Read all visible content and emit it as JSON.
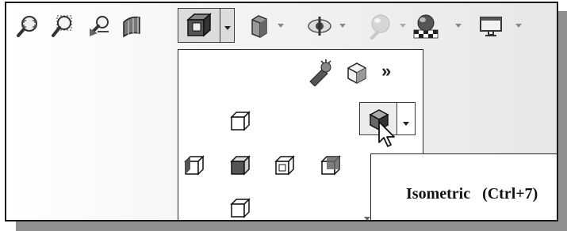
{
  "toolbar": {
    "buttons": [
      {
        "icon": "zoom-to-fit-icon"
      },
      {
        "icon": "zoom-to-area-icon"
      },
      {
        "icon": "previous-view-icon"
      },
      {
        "icon": "section-view-icon"
      },
      {
        "icon": "view-orientation-icon",
        "pressed": true
      },
      {
        "icon": "display-style-icon"
      },
      {
        "icon": "hide-show-items-icon"
      },
      {
        "icon": "edit-appearance-icon"
      },
      {
        "icon": "apply-scene-icon"
      },
      {
        "icon": "view-settings-icon"
      }
    ]
  },
  "view_menu": {
    "top_icons": [
      "new-view-icon",
      "view-selector-icon",
      "more-icon"
    ],
    "more_label": "»",
    "iso_button_icon": "isometric-icon",
    "orientations": [
      "top",
      "left",
      "front",
      "right",
      "back",
      "bottom"
    ]
  },
  "tooltip": {
    "title": "Isometric",
    "shortcut": "(Ctrl+7)"
  },
  "colors": {
    "frame": "#1a1a1a",
    "shadow": "#8f8f8f",
    "pressed_bg": "#dcdcdc"
  }
}
